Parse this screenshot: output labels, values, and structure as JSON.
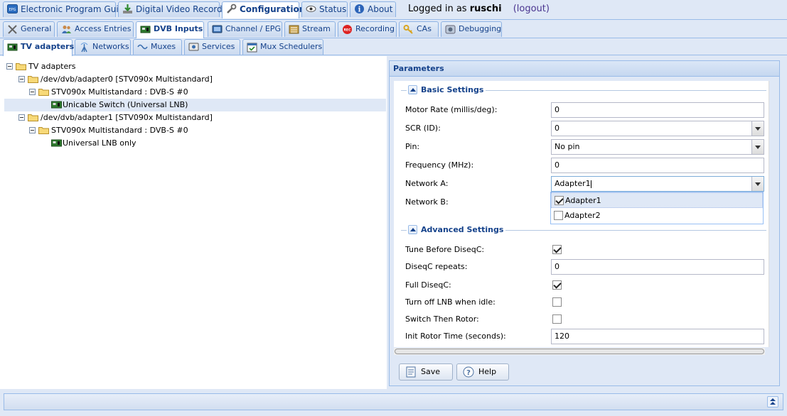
{
  "top_tabs": [
    {
      "label": "Electronic Program Guide",
      "icon": "epg-icon"
    },
    {
      "label": "Digital Video Recorder",
      "icon": "download-icon"
    },
    {
      "label": "Configuration",
      "icon": "wrench-icon",
      "active": true
    },
    {
      "label": "Status",
      "icon": "eye-icon"
    },
    {
      "label": "About",
      "icon": "info-icon"
    }
  ],
  "login": {
    "prefix": "Logged in as",
    "user": "ruschi",
    "logout": "(logout)"
  },
  "config_tabs": [
    {
      "label": "General",
      "icon": "tools-icon"
    },
    {
      "label": "Access Entries",
      "icon": "users-icon"
    },
    {
      "label": "DVB Inputs",
      "icon": "card-icon",
      "active": true
    },
    {
      "label": "Channel / EPG",
      "icon": "tv-icon"
    },
    {
      "label": "Stream",
      "icon": "stream-icon"
    },
    {
      "label": "Recording",
      "icon": "rec-icon"
    },
    {
      "label": "CAs",
      "icon": "key-icon"
    },
    {
      "label": "Debugging",
      "icon": "debug-icon"
    }
  ],
  "dvb_tabs": [
    {
      "label": "TV adapters",
      "icon": "card-icon",
      "active": true
    },
    {
      "label": "Networks",
      "icon": "antenna-icon"
    },
    {
      "label": "Muxes",
      "icon": "mux-icon"
    },
    {
      "label": "Services",
      "icon": "services-icon"
    },
    {
      "label": "Mux Schedulers",
      "icon": "calendar-icon"
    }
  ],
  "tree": [
    {
      "label": "TV adapters"
    },
    {
      "label": "/dev/dvb/adapter0 [STV090x Multistandard]"
    },
    {
      "label": "STV090x Multistandard : DVB-S #0"
    },
    {
      "label": "Unicable Switch (Universal LNB)"
    },
    {
      "label": "/dev/dvb/adapter1 [STV090x Multistandard]"
    },
    {
      "label": "STV090x Multistandard : DVB-S #0"
    },
    {
      "label": "Universal LNB only"
    }
  ],
  "panel": {
    "title": "Parameters",
    "basic_legend": "Basic Settings",
    "advanced_legend": "Advanced Settings",
    "basic": [
      {
        "label": "Motor Rate (millis/deg):",
        "value": "0"
      },
      {
        "label": "SCR (ID):",
        "value": "0"
      },
      {
        "label": "Pin:",
        "value": "No pin"
      },
      {
        "label": "Frequency (MHz):",
        "value": "0"
      },
      {
        "label": "Network A:",
        "value": "Adapter1"
      },
      {
        "label": "Network B:"
      }
    ],
    "network_options": [
      {
        "label": "Adapter1",
        "checked": true
      },
      {
        "label": "Adapter2",
        "checked": false
      }
    ],
    "advanced": [
      {
        "label": "Tune Before DiseqC:",
        "checked": true
      },
      {
        "label": "DiseqC repeats:",
        "value": "0"
      },
      {
        "label": "Full DiseqC:",
        "checked": true
      },
      {
        "label": "Turn off LNB when idle:",
        "checked": false
      },
      {
        "label": "Switch Then Rotor:",
        "checked": false
      },
      {
        "label": "Init Rotor Time (seconds):",
        "value": "120"
      }
    ],
    "save_label": "Save",
    "help_label": "Help"
  }
}
